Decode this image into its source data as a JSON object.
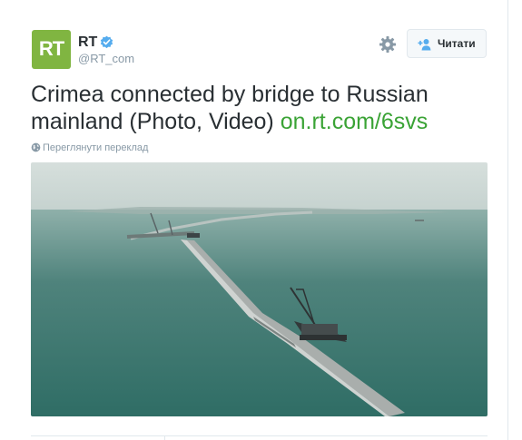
{
  "account": {
    "name": "RT",
    "handle": "@RT_com",
    "avatar_text": "RT",
    "avatar_color": "#80b541",
    "verified_icon": "verified-badge-icon"
  },
  "actions": {
    "settings_icon": "gear-icon",
    "follow_label": "Читати",
    "follow_icon": "add-user-icon"
  },
  "tweet": {
    "text": "Crimea connected by bridge to Russian mainland (Photo, Video) ",
    "link": "on.rt.com/6svs",
    "translate_label": "Переглянути переклад",
    "translate_icon": "globe-icon"
  },
  "media": {
    "description_icon": "photo"
  },
  "colors": {
    "link": "#3aa335",
    "verified": "#55acee",
    "muted": "#8899a6"
  }
}
